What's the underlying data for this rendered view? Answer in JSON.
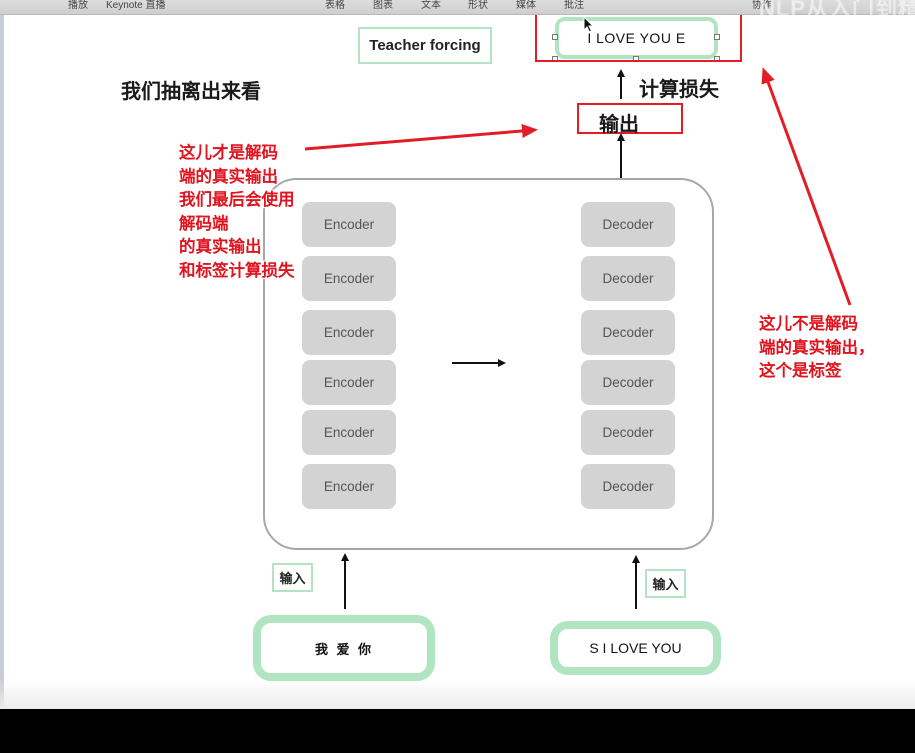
{
  "toolbar": {
    "items": [
      "播放",
      "Keynote 直播",
      "表格",
      "图表",
      "文本",
      "形状",
      "媒体",
      "批注",
      "协作"
    ],
    "watermark": "NLP从入门到精"
  },
  "slide": {
    "teacher_forcing_label": "Teacher forcing",
    "section_title": "我们抽离出来看",
    "label_box_text": "I LOVE YOU E",
    "loss_label": "计算损失",
    "output_label": "输出",
    "encoder_label": "Encoder",
    "decoder_label": "Decoder",
    "encoders": [
      "Encoder",
      "Encoder",
      "Encoder",
      "Encoder",
      "Encoder",
      "Encoder"
    ],
    "decoders": [
      "Decoder",
      "Decoder",
      "Decoder",
      "Decoder",
      "Decoder",
      "Decoder"
    ],
    "encoder_input_tag": "输入",
    "decoder_input_tag": "输入",
    "encoder_input_text": "我 爱 你",
    "decoder_input_text": "S I LOVE YOU"
  },
  "annotations": {
    "left_note": "这儿才是解码\n端的真实输出\n我们最后会使用\n解码端\n的真实输出\n和标签计算损失",
    "right_note": "这儿不是解码\n端的真实输出，\n这个是标签",
    "annotation_color": "#e21d25"
  },
  "colors": {
    "box_border_green": "#b1e5c1",
    "block_gray": "#d3d3d3",
    "frame_gray": "#a8a8a8"
  }
}
